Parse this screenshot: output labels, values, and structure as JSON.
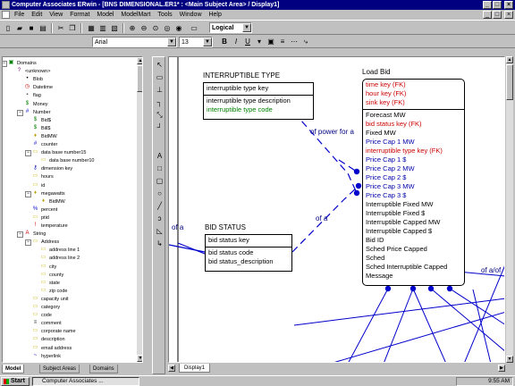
{
  "window": {
    "title": "Computer Associates ERwin - [BNS DIMENSIONAL.ER1* : <Main Subject Area> / Display1]",
    "controls": {
      "minimize": "_",
      "maximize": "□",
      "close": "×"
    }
  },
  "menu": [
    "File",
    "Edit",
    "View",
    "Format",
    "Model",
    "ModelMart",
    "Tools",
    "Window",
    "Help"
  ],
  "toolbar": {
    "display_level": "Logical",
    "font_name": "Arial",
    "font_size": "13"
  },
  "format_toolbar": {
    "bold": "B",
    "italic": "I",
    "underline": "U"
  },
  "tree": {
    "items": [
      {
        "label": "Domains",
        "icon": "domains-icon",
        "glyph": "▣"
      },
      {
        "label": "<unknown>",
        "icon": "question-icon",
        "glyph": "?"
      },
      {
        "label": "Blob",
        "icon": "dot-icon",
        "glyph": "•"
      },
      {
        "label": "Datetime",
        "icon": "clock-icon",
        "glyph": "◷"
      },
      {
        "label": "flag",
        "icon": "flag-icon",
        "glyph": "▪"
      },
      {
        "label": "Money",
        "icon": "dollar-icon",
        "glyph": "$"
      },
      {
        "label": "Number",
        "icon": "number-icon",
        "glyph": "#"
      },
      {
        "label": "Bid$",
        "icon": "dollar-icon",
        "glyph": "$"
      },
      {
        "label": "Bill$",
        "icon": "dollar-icon",
        "glyph": "$"
      },
      {
        "label": "BidMW",
        "icon": "bulb-icon",
        "glyph": "♦"
      },
      {
        "label": "counter",
        "icon": "counter-icon",
        "glyph": "#"
      },
      {
        "label": "data base number15",
        "icon": "folder-icon",
        "glyph": "▭"
      },
      {
        "label": "data base number10",
        "icon": "folder-icon",
        "glyph": "▭"
      },
      {
        "label": "dimension key",
        "icon": "key-icon",
        "glyph": "⚷"
      },
      {
        "label": "hours",
        "icon": "folder-icon",
        "glyph": "▭"
      },
      {
        "label": "id",
        "icon": "folder-icon",
        "glyph": "▭"
      },
      {
        "label": "megawatts",
        "icon": "bulb-icon",
        "glyph": "♦"
      },
      {
        "label": "BidMW",
        "icon": "bulb-icon",
        "glyph": "♦"
      },
      {
        "label": "percent",
        "icon": "percent-icon",
        "glyph": "%"
      },
      {
        "label": "ptid",
        "icon": "folder-icon",
        "glyph": "▭"
      },
      {
        "label": "temperature",
        "icon": "thermometer-icon",
        "glyph": "!"
      },
      {
        "label": "String",
        "icon": "string-icon",
        "glyph": "A"
      },
      {
        "label": "Address",
        "icon": "folder-icon",
        "glyph": "▭"
      },
      {
        "label": "address line 1",
        "icon": "folder-icon",
        "glyph": "▭"
      },
      {
        "label": "address line 2",
        "icon": "folder-icon",
        "glyph": "▭"
      },
      {
        "label": "city",
        "icon": "folder-icon",
        "glyph": "▭"
      },
      {
        "label": "county",
        "icon": "folder-icon",
        "glyph": "▭"
      },
      {
        "label": "state",
        "icon": "folder-icon",
        "glyph": "▭"
      },
      {
        "label": "zip code",
        "icon": "folder-icon",
        "glyph": "▭"
      },
      {
        "label": "capacity unit",
        "icon": "folder-icon",
        "glyph": "▭"
      },
      {
        "label": "category",
        "icon": "folder-icon",
        "glyph": "▭"
      },
      {
        "label": "code",
        "icon": "folder-icon",
        "glyph": "▭"
      },
      {
        "label": "comment",
        "icon": "comment-icon",
        "glyph": "≡"
      },
      {
        "label": "corporate name",
        "icon": "folder-icon",
        "glyph": "▭"
      },
      {
        "label": "description",
        "icon": "folder-icon",
        "glyph": "▭"
      },
      {
        "label": "email address",
        "icon": "folder-icon",
        "glyph": "▭"
      },
      {
        "label": "hyperlink",
        "icon": "link-icon",
        "glyph": "~"
      }
    ]
  },
  "left_tabs": [
    "Model",
    "Subject Areas",
    "Domains"
  ],
  "diagram": {
    "entities": {
      "interruptible_type": {
        "title": "INTERRUPTIBLE TYPE",
        "key_attributes": [
          {
            "text": "interruptible type key",
            "color": "#000000"
          }
        ],
        "attributes": [
          {
            "text": "interruptible type description",
            "color": "#000000"
          },
          {
            "text": "interruptible type code",
            "color": "#008000"
          }
        ]
      },
      "bid_status": {
        "title": "BID STATUS",
        "key_attributes": [
          {
            "text": "bid status key",
            "color": "#000000"
          }
        ],
        "attributes": [
          {
            "text": "bid status code",
            "color": "#000000"
          },
          {
            "text": "bid status_description",
            "color": "#000000"
          }
        ]
      },
      "load_bid": {
        "title": "Load Bid",
        "key_attributes": [
          {
            "text": "time key (FK)",
            "color": "#cc0000"
          },
          {
            "text": "hour key (FK)",
            "color": "#cc0000"
          },
          {
            "text": "sink key (FK)",
            "color": "#cc0000"
          }
        ],
        "attributes": [
          {
            "text": "Forecast MW",
            "color": "#000000"
          },
          {
            "text": "bid status key (FK)",
            "color": "#cc0000"
          },
          {
            "text": "Fixed MW",
            "color": "#000000"
          },
          {
            "text": "Price Cap 1 MW",
            "color": "#0000aa"
          },
          {
            "text": "interruptible type key (FK)",
            "color": "#cc0000"
          },
          {
            "text": "Price Cap 1 $",
            "color": "#0000aa"
          },
          {
            "text": "Price Cap 2 MW",
            "color": "#0000aa"
          },
          {
            "text": "Price Cap 2 $",
            "color": "#0000aa"
          },
          {
            "text": "Price Cap 3 MW",
            "color": "#0000aa"
          },
          {
            "text": "Price Cap 3 $",
            "color": "#0000aa"
          },
          {
            "text": "Interruptible Fixed MW",
            "color": "#000000"
          },
          {
            "text": "Interruptible Fixed $",
            "color": "#000000"
          },
          {
            "text": "Interruptible Capped MW",
            "color": "#000000"
          },
          {
            "text": "Interruptible Capped $",
            "color": "#000000"
          },
          {
            "text": "Bid ID",
            "color": "#000000"
          },
          {
            "text": "Sched Price Capped",
            "color": "#000000"
          },
          {
            "text": "Sched",
            "color": "#000000"
          },
          {
            "text": "Sched Interruptible Capped",
            "color": "#000000"
          },
          {
            "text": "Message",
            "color": "#000000"
          }
        ]
      }
    },
    "relationships": [
      "of power for a",
      "of a",
      "of a",
      "of a/of"
    ]
  },
  "doc_tab": "Display1",
  "taskbar": {
    "start": "Start",
    "task": "Computer Associates ...",
    "time": "9:55 AM"
  }
}
